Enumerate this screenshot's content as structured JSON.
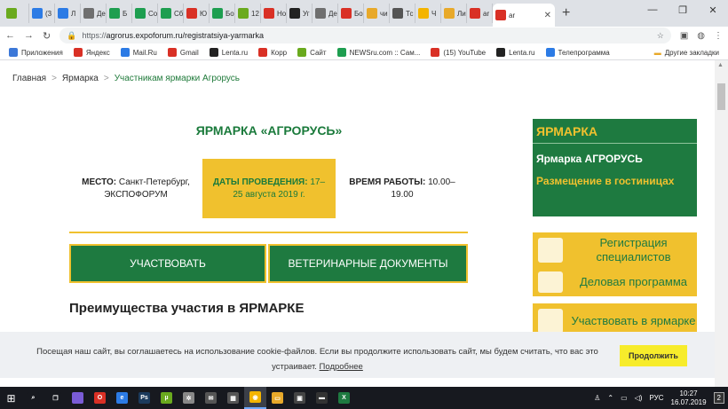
{
  "browser": {
    "tabs": [
      {
        "title": "",
        "color": "#6aaa1e"
      },
      {
        "title": "(3",
        "color": "#2c7be5"
      },
      {
        "title": "Л",
        "color": "#2c7be5"
      },
      {
        "title": "Де",
        "color": "#6f6f6f"
      },
      {
        "title": "Б",
        "color": "#1e9e50"
      },
      {
        "title": "Со",
        "color": "#1e9e50"
      },
      {
        "title": "Сб",
        "color": "#1e9e50"
      },
      {
        "title": "Ю",
        "color": "#d93025"
      },
      {
        "title": "Бо",
        "color": "#1e9e50"
      },
      {
        "title": "12",
        "color": "#6aaa1e"
      },
      {
        "title": "Но",
        "color": "#d93025"
      },
      {
        "title": "Уг",
        "color": "#222222"
      },
      {
        "title": "Де",
        "color": "#6f6f6f"
      },
      {
        "title": "Бо",
        "color": "#d93025"
      },
      {
        "title": "чи",
        "color": "#e8a92a"
      },
      {
        "title": "Тс",
        "color": "#555555"
      },
      {
        "title": "Ч",
        "color": "#f4b400"
      },
      {
        "title": "Ли",
        "color": "#e8a92a"
      },
      {
        "title": "ar",
        "color": "#d93025"
      }
    ],
    "active_tab": {
      "title": "ar",
      "color": "#d93025"
    },
    "url_scheme": "https://",
    "url_rest": "agrorus.expoforum.ru/registratsiya-yarmarka",
    "bookmarks": [
      {
        "label": "Приложения",
        "color": "#3c78d8"
      },
      {
        "label": "Яндекс",
        "color": "#d93025"
      },
      {
        "label": "Mail.Ru",
        "color": "#2c7be5"
      },
      {
        "label": "Gmail",
        "color": "#d93025"
      },
      {
        "label": "Lenta.ru",
        "color": "#222222"
      },
      {
        "label": "Корр",
        "color": "#d93025"
      },
      {
        "label": "Сайт",
        "color": "#6aaa1e"
      },
      {
        "label": "NEWSru.com :: Сам...",
        "color": "#1e9e50"
      },
      {
        "label": "(15) YouTube",
        "color": "#d93025"
      },
      {
        "label": "Lenta.ru",
        "color": "#222222"
      },
      {
        "label": "Телепрограмма",
        "color": "#2c7be5"
      }
    ],
    "other_bookmarks": "Другие закладки"
  },
  "breadcrumbs": {
    "home": "Главная",
    "section": "Ярмарка",
    "current": "Участникам ярмарки Агрорусь",
    "separator": ">"
  },
  "fair": {
    "title": "ЯРМАРКА «АГРОРУСЬ»",
    "place_label": "МЕСТО:",
    "place_value": "Санкт-Петербург, ЭКСПОФОРУМ",
    "dates_label": "ДАТЫ ПРОВЕДЕНИЯ:",
    "dates_value": "17–25 августа 2019 г.",
    "hours_label": "ВРЕМЯ РАБОТЫ:",
    "hours_value": "10.00–19.00",
    "participate_button": "УЧАСТВОВАТЬ",
    "vet_docs_button": "ВЕТЕРИНАРНЫЕ ДОКУМЕНТЫ",
    "advantages_title": "Преимущества участия в ЯРМАРКЕ"
  },
  "sidebar": {
    "header": "ЯРМАРКА",
    "fair_name": "Ярмарка АГРОРУСЬ",
    "hotel_link": "Размещение в гостиницах",
    "buttons": [
      {
        "label": "Регистрация специалистов"
      },
      {
        "label": "Деловая программа"
      },
      {
        "label": "Участвовать в ярмарке"
      }
    ]
  },
  "cookie": {
    "text": "Посещая наш сайт, вы соглашаетесь на использование cookie-файлов. Если вы продолжите использовать сайт, мы будем считать, что вас это устраивает.",
    "more_link": "Подробнее",
    "continue_button": "Продолжить"
  },
  "taskbar": {
    "apps": [
      {
        "name": "search",
        "color": "#17191f",
        "glyph": "⌕"
      },
      {
        "name": "task-view",
        "color": "#17191f",
        "glyph": "❐"
      },
      {
        "name": "app",
        "color": "#7a5cd6",
        "glyph": ""
      },
      {
        "name": "opera",
        "color": "#d93025",
        "glyph": "O"
      },
      {
        "name": "edge",
        "color": "#2c7be5",
        "glyph": "e"
      },
      {
        "name": "photoshop",
        "color": "#1b3a5c",
        "glyph": "Ps"
      },
      {
        "name": "torrent",
        "color": "#6aaa1e",
        "glyph": "µ"
      },
      {
        "name": "media",
        "color": "#888888",
        "glyph": "✲"
      },
      {
        "name": "mail",
        "color": "#555555",
        "glyph": "✉"
      },
      {
        "name": "calculator",
        "color": "#555555",
        "glyph": "▦"
      },
      {
        "name": "chrome",
        "color": "#f4b400",
        "glyph": "◉"
      },
      {
        "name": "explorer",
        "color": "#e8a92a",
        "glyph": "▭"
      },
      {
        "name": "film",
        "color": "#444444",
        "glyph": "▣"
      },
      {
        "name": "cmd",
        "color": "#333333",
        "glyph": "▬"
      },
      {
        "name": "excel",
        "color": "#1e7a40",
        "glyph": "X"
      }
    ],
    "language": "РУС",
    "time": "10:27",
    "date": "16.07.2019",
    "notifications": "2"
  }
}
